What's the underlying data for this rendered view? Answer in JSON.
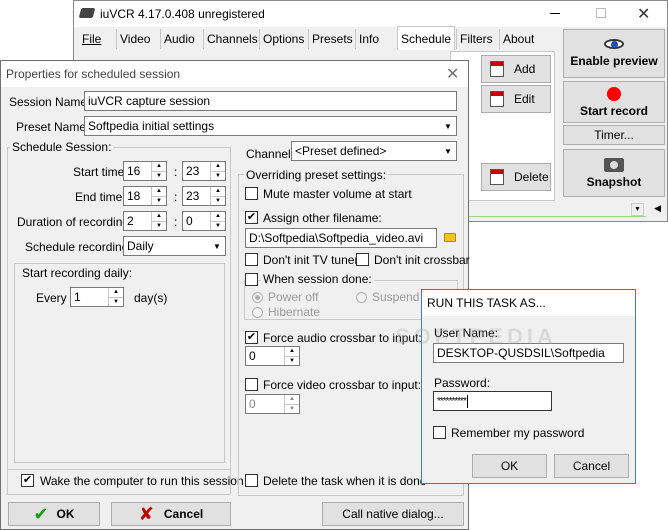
{
  "main_window": {
    "title": "iuVCR 4.17.0.408 unregistered",
    "tabs": [
      {
        "label": "File"
      },
      {
        "label": "Video"
      },
      {
        "label": "Audio"
      },
      {
        "label": "Channels"
      },
      {
        "label": "Options"
      },
      {
        "label": "Presets"
      },
      {
        "label": "Info"
      },
      {
        "label": "Schedule",
        "active": true
      },
      {
        "label": "Filters"
      },
      {
        "label": "About"
      }
    ],
    "schedule_buttons": {
      "add": "Add",
      "edit": "Edit",
      "delete": "Delete"
    },
    "right_panel": {
      "enable_preview": "Enable preview",
      "start_record": "Start record",
      "timer": "Timer...",
      "snapshot": "Snapshot"
    }
  },
  "properties_dialog": {
    "title": "Properties for scheduled session",
    "session_name_label": "Session Name:",
    "session_name_value": "iuVCR capture session",
    "preset_name_label": "Preset Name:",
    "preset_name_value": "Softpedia initial settings",
    "schedule_session": {
      "group_label": "Schedule Session:",
      "start_time_label": "Start time:",
      "start_hour": "16",
      "start_minute": "23",
      "end_time_label": "End time:",
      "end_hour": "18",
      "end_minute": "23",
      "duration_label": "Duration of recording:",
      "duration_hour": "2",
      "duration_minute": "0",
      "colon": ":",
      "schedule_recording_label": "Schedule recording:",
      "schedule_recording_value": "Daily",
      "daily_group_label": "Start recording daily:",
      "every_label": "Every",
      "every_value": "1",
      "days_label": "day(s)"
    },
    "wake_label": "Wake the computer to run this session",
    "wake_checked": true,
    "channel_label": "Channel:",
    "channel_value": "<Preset defined>",
    "overriding": {
      "group_label": "Overriding preset settings:",
      "mute_label": "Mute master volume at start",
      "mute_checked": false,
      "assign_label": "Assign other filename:",
      "assign_checked": true,
      "filename_value": "D:\\Softpedia\\Softpedia_video.avi",
      "dont_init_tv_label": "Don't init TV tuner",
      "dont_init_crossbar_label": "Don't init crossbar",
      "when_done_label": "When session done:",
      "power_off_label": "Power off",
      "suspend_label": "Suspend",
      "hibernate_label": "Hibernate",
      "force_audio_label": "Force audio crossbar to input:",
      "force_audio_checked": true,
      "force_audio_value": "0",
      "force_video_label": "Force video crossbar to input:",
      "force_video_checked": false,
      "force_video_value": "0",
      "delete_task_label": "Delete the task when it is done"
    },
    "ok_label": "OK",
    "cancel_label": "Cancel",
    "native_label": "Call native dialog..."
  },
  "run_as_dialog": {
    "title": "RUN THIS TASK AS...",
    "username_label": "User Name:",
    "username_value": "DESKTOP-QUSDSIL\\Softpedia",
    "password_label": "Password:",
    "password_value": "**********",
    "remember_label": "Remember my password",
    "ok_label": "OK",
    "cancel_label": "Cancel"
  },
  "watermark": "SOFTPEDIA"
}
